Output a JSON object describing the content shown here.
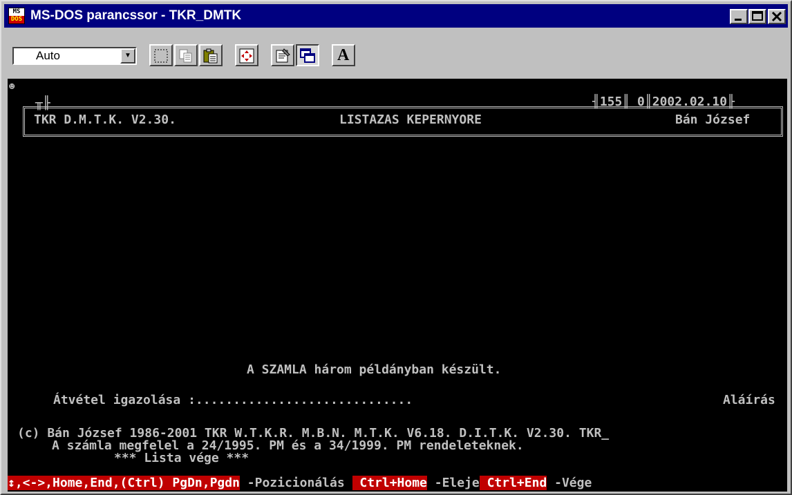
{
  "window": {
    "title": "MS-DOS parancssor - TKR_DMTK",
    "icon_top": "MS",
    "icon_bottom": "DOS",
    "minimize_icon": "minimize-icon",
    "maximize_icon": "maximize-icon",
    "close_icon": "close-icon"
  },
  "toolbar": {
    "font_select_value": "Auto",
    "buttons": [
      "mark-icon",
      "copy-icon",
      "paste-icon",
      "fullscreen-icon",
      "properties-icon",
      "background-icon",
      "font-icon"
    ],
    "font_button_label": "A"
  },
  "console": {
    "smiley": "☻",
    "header": {
      "app_name": "TKR D.M.T.K. V2.30.",
      "screen_title": "LISTAZAS KEPERNYORE",
      "counter_1": "155",
      "counter_2": "0",
      "date": "2002.02.10",
      "user": "Bán József"
    },
    "invoice_note": "A SZAMLA három példányban készült.",
    "receipt_label": "Átvétel igazolása :.............................",
    "signature_label": "Aláírás",
    "copyright_line": "(c) Bán József 1986-2001 TKR W.T.K.R. M.B.N. M.T.K. V6.18. D.I.T.K. V2.30. TKR_",
    "regulation_line": "A számla megfelel a 24/1995. PM és a 34/1999. PM rendeleteknek.",
    "list_end": "*** Lista vége ***"
  },
  "statusbar": {
    "keys_1": "↕,<->,Home,End,(Ctrl) PgDn,Pgdn",
    "action_1": " -Pozicionálás ",
    "keys_2": " Ctrl+Home",
    "action_2": " -Eleje",
    "keys_3": " Ctrl+End",
    "action_3": " -Vége"
  },
  "colors": {
    "titlebar": "#000080",
    "console_bg": "#000000",
    "console_fg": "#c0c0c0",
    "status_highlight": "#c00000"
  }
}
